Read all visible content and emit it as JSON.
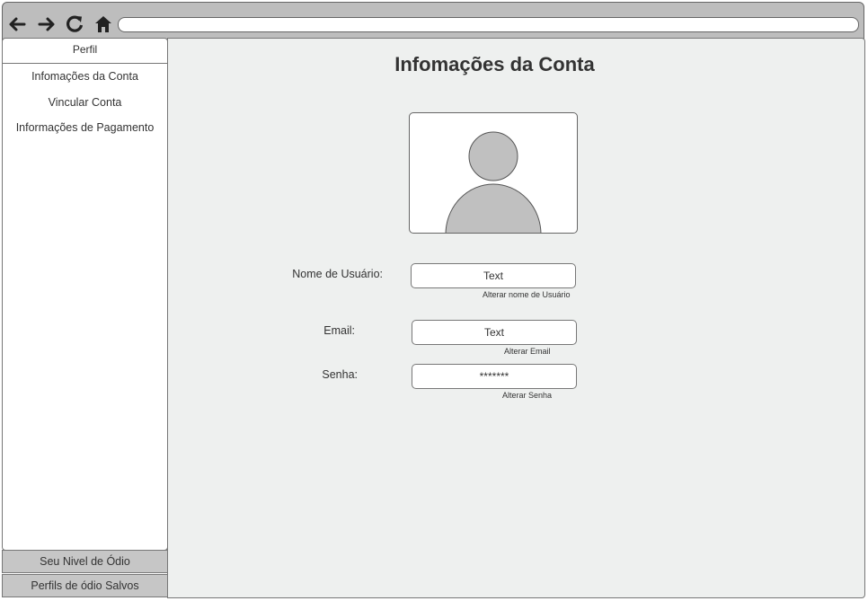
{
  "browser": {
    "icons": [
      "back-arrow-icon",
      "forward-arrow-icon",
      "reload-icon",
      "home-icon"
    ],
    "url": ""
  },
  "sidebar": {
    "header": "Perfil",
    "items": [
      {
        "label": "Infomações da Conta"
      },
      {
        "label": "Vincular Conta"
      },
      {
        "label": "Informações de Pagamento"
      }
    ],
    "bottom_items": [
      {
        "label": "Seu Nivel de Ódio"
      },
      {
        "label": "Perfils de ódio Salvos"
      }
    ]
  },
  "main": {
    "title": "Infomações da Conta",
    "avatar_icon": "user-placeholder-icon",
    "fields": {
      "username": {
        "label": "Nome de Usuário:",
        "value": "Text",
        "link": "Alterar nome de Usuário"
      },
      "email": {
        "label": "Email:",
        "value": "Text",
        "link": "Alterar Email"
      },
      "password": {
        "label": "Senha:",
        "value": "*******",
        "link": "Alterar Senha"
      }
    }
  },
  "colors": {
    "toolbar_bg": "#bdbdbd",
    "main_bg": "#eef0ef",
    "sidebar_bottom_bg": "#c6c6c6",
    "avatar_fill": "#c0c0c0"
  }
}
